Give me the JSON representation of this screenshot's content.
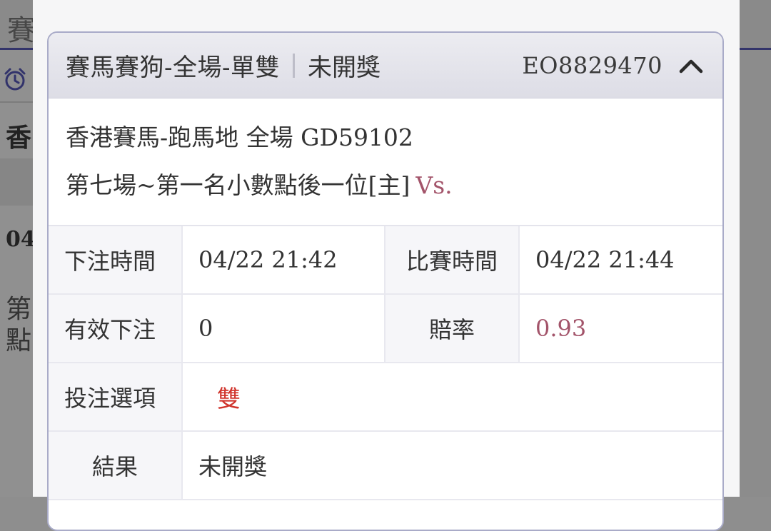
{
  "background": {
    "tab_char": "賽",
    "row_text_1": "香",
    "row_text_2": "04",
    "row_text_3": "第",
    "row_text_4": "點"
  },
  "card": {
    "title": "賽馬賽狗-全場-單雙",
    "status": "未開獎",
    "order_id": "EO8829470",
    "event_line1": "香港賽馬-跑馬地 全場 GD59102",
    "event_line2": "第七場~第一名小數點後一位[主]",
    "vs": "Vs.",
    "rows": {
      "bet_time_label": "下注時間",
      "bet_time_value": "04/22 21:42",
      "match_time_label": "比賽時間",
      "match_time_value": "04/22 21:44",
      "valid_bet_label": "有效下注",
      "valid_bet_value": "0",
      "odds_label": "賠率",
      "odds_value": "0.93",
      "option_label": "投注選項",
      "option_value": "雙",
      "result_label": "結果",
      "result_value": "未開獎"
    }
  },
  "colors": {
    "accent": "#a3546a",
    "pick": "#d0342c",
    "border": "#a9abc8"
  },
  "icons": {
    "header_toggle": "chevron-up-icon",
    "background": "alarm-clock-icon"
  }
}
